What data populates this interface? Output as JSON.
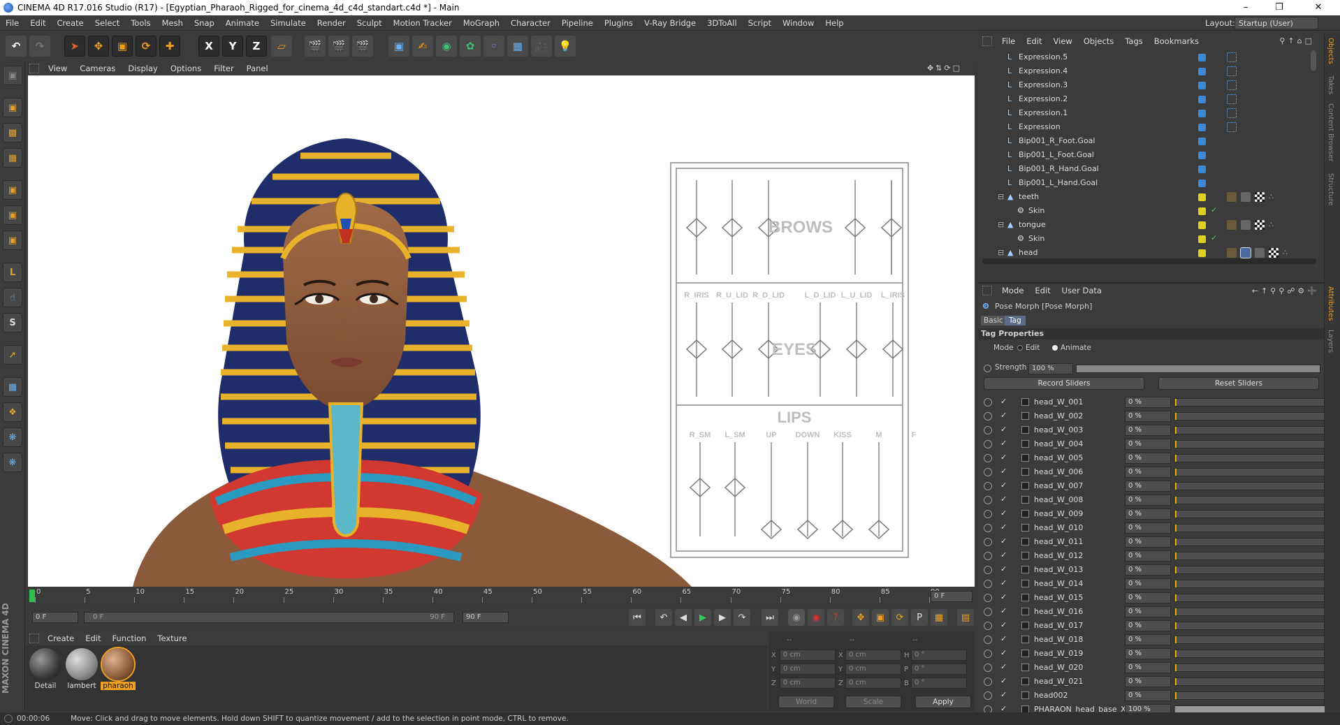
{
  "window": {
    "title": "CINEMA 4D R17.016 Studio (R17) - [Egyptian_Pharaoh_Rigged_for_cinema_4d_c4d_standart.c4d *] - Main",
    "minimize": "–",
    "maximize": "❒",
    "close": "✕"
  },
  "menubar": {
    "items": [
      "File",
      "Edit",
      "Create",
      "Select",
      "Tools",
      "Mesh",
      "Snap",
      "Animate",
      "Simulate",
      "Render",
      "Sculpt",
      "Motion Tracker",
      "MoGraph",
      "Character",
      "Pipeline",
      "Plugins",
      "V-Ray Bridge",
      "3DToAll",
      "Script",
      "Window",
      "Help"
    ],
    "layout_label": "Layout:",
    "layout_value": "Startup (User)"
  },
  "toolbar": {
    "axis_x": "X",
    "axis_y": "Y",
    "axis_z": "Z"
  },
  "left_tools": {
    "sculpt_label": "S",
    "maxon_label": "MAXON CINEMA 4D"
  },
  "viewport": {
    "menu": [
      "View",
      "Cameras",
      "Display",
      "Options",
      "Filter",
      "Panel"
    ],
    "rig_panel": {
      "brows_label": "BROWS",
      "eyes_label": "EYES",
      "lips_label": "LIPS",
      "eye_sliders": [
        "R_IRIS",
        "R_U_LID",
        "R_D_LID",
        "L_D_LID",
        "L_U_LID",
        "L_IRIS"
      ],
      "lip_sliders": [
        "R_SM",
        "L_SM",
        "UP",
        "DOWN",
        "KISS",
        "M",
        "F"
      ]
    }
  },
  "timeline": {
    "ticks": [
      "0",
      "5",
      "10",
      "15",
      "20",
      "25",
      "30",
      "35",
      "40",
      "45",
      "50",
      "55",
      "60",
      "65",
      "70",
      "75",
      "80",
      "85",
      "90"
    ],
    "current_frame": "0 F",
    "start_field": "0 F",
    "range_start": "0 F",
    "range_end": "90 F",
    "end_field": "90 F",
    "autokey_label": "P"
  },
  "materials": {
    "menu": [
      "Create",
      "Edit",
      "Function",
      "Texture"
    ],
    "items": [
      {
        "name": "Detail",
        "color": "#5a4a3a"
      },
      {
        "name": "lambert",
        "color": "#9a9a9a"
      },
      {
        "name": "pharaoh",
        "color": "#8a5a3a"
      }
    ]
  },
  "coordinates": {
    "header": [
      "--",
      "--",
      "--"
    ],
    "rows": [
      {
        "a": "X",
        "av": "0 cm",
        "b": "X",
        "bv": "0 cm",
        "c": "H",
        "cv": "0 °"
      },
      {
        "a": "Y",
        "av": "0 cm",
        "b": "Y",
        "bv": "0 cm",
        "c": "P",
        "cv": "0 °"
      },
      {
        "a": "Z",
        "av": "0 cm",
        "b": "Z",
        "bv": "0 cm",
        "c": "B",
        "cv": "0 °"
      }
    ],
    "mode_world": "World",
    "mode_scale": "Scale",
    "apply": "Apply"
  },
  "objects": {
    "menu": [
      "File",
      "Edit",
      "View",
      "Objects",
      "Tags",
      "Bookmarks"
    ],
    "rows": [
      {
        "name": "Expression.5",
        "color": "#3a8ad8"
      },
      {
        "name": "Expression.4",
        "color": "#3a8ad8"
      },
      {
        "name": "Expression.3",
        "color": "#3a8ad8"
      },
      {
        "name": "Expression.2",
        "color": "#3a8ad8"
      },
      {
        "name": "Expression.1",
        "color": "#3a8ad8"
      },
      {
        "name": "Expression",
        "color": "#3a8ad8"
      },
      {
        "name": "Bip001_R_Foot.Goal",
        "color": "#3a8ad8"
      },
      {
        "name": "Bip001_L_Foot.Goal",
        "color": "#3a8ad8"
      },
      {
        "name": "Bip001_R_Hand.Goal",
        "color": "#3a8ad8"
      },
      {
        "name": "Bip001_L_Hand.Goal",
        "color": "#3a8ad8"
      },
      {
        "name": "teeth",
        "color": "#e0d020"
      },
      {
        "name": "Skin",
        "color": "#e0d020"
      },
      {
        "name": "tongue",
        "color": "#e0d020"
      },
      {
        "name": "Skin",
        "color": "#e0d020"
      },
      {
        "name": "head",
        "color": "#e0d020"
      }
    ]
  },
  "sidetabs": [
    "Objects",
    "Takes",
    "Content Browser",
    "Structure",
    "Attributes",
    "Layers"
  ],
  "attributes": {
    "menu": [
      "Mode",
      "Edit",
      "User Data"
    ],
    "object_title": "Pose Morph [Pose Morph]",
    "tab_basic": "Basic",
    "tab_tag": "Tag",
    "section": "Tag Properties",
    "mode_label": "Mode",
    "mode_edit": "Edit",
    "mode_animate": "Animate",
    "strength_label": "Strength",
    "strength_value": "100 %",
    "record_button": "Record Sliders",
    "reset_button": "Reset Sliders",
    "sliders": [
      {
        "name": "head_W_001",
        "value": "0 %",
        "level": 0
      },
      {
        "name": "head_W_002",
        "value": "0 %",
        "level": 0
      },
      {
        "name": "head_W_003",
        "value": "0 %",
        "level": 0
      },
      {
        "name": "head_W_004",
        "value": "0 %",
        "level": 0
      },
      {
        "name": "head_W_005",
        "value": "0 %",
        "level": 0
      },
      {
        "name": "head_W_006",
        "value": "0 %",
        "level": 0
      },
      {
        "name": "head_W_007",
        "value": "0 %",
        "level": 0
      },
      {
        "name": "head_W_008",
        "value": "0 %",
        "level": 0
      },
      {
        "name": "head_W_009",
        "value": "0 %",
        "level": 0
      },
      {
        "name": "head_W_010",
        "value": "0 %",
        "level": 0
      },
      {
        "name": "head_W_011",
        "value": "0 %",
        "level": 0
      },
      {
        "name": "head_W_012",
        "value": "0 %",
        "level": 0
      },
      {
        "name": "head_W_013",
        "value": "0 %",
        "level": 0
      },
      {
        "name": "head_W_014",
        "value": "0 %",
        "level": 0
      },
      {
        "name": "head_W_015",
        "value": "0 %",
        "level": 0
      },
      {
        "name": "head_W_016",
        "value": "0 %",
        "level": 0
      },
      {
        "name": "head_W_017",
        "value": "0 %",
        "level": 0
      },
      {
        "name": "head_W_018",
        "value": "0 %",
        "level": 0
      },
      {
        "name": "head_W_019",
        "value": "0 %",
        "level": 0
      },
      {
        "name": "head_W_020",
        "value": "0 %",
        "level": 0
      },
      {
        "name": "head_W_021",
        "value": "0 %",
        "level": 0
      },
      {
        "name": "head002",
        "value": "0 %",
        "level": 0
      },
      {
        "name": "PHARAON_head_base_XY",
        "value": "100 %",
        "level": 1
      }
    ]
  },
  "status": {
    "time": "00:00:06",
    "message": "Move: Click and drag to move elements. Hold down SHIFT to quantize movement / add to the selection in point mode, CTRL to remove."
  }
}
